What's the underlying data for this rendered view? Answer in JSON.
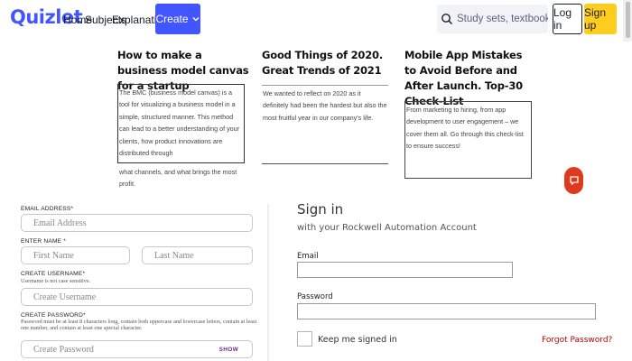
{
  "header": {
    "logo": "Quizlet",
    "nav": [
      "Home",
      "Subjects",
      "Explanations"
    ],
    "create_label": "Create",
    "search_placeholder": "Study sets, textbooks, ...",
    "login_label": "Log in",
    "signup_label": "Sign up",
    "brand_color": "#4255ff",
    "signup_color": "#ffcd1f"
  },
  "articles": [
    {
      "title": "How to make a business model canvas for a startup",
      "excerpt": "The BMC (business model canvas) is a tool for visualizing a business model in a simple, structured manner. This method can lead to a better understanding of your clients, how product innovations are distributed through",
      "excerpt_more": "what channels, and what brings the most profit."
    },
    {
      "title": "Good Things of 2020. Great Trends of 2021",
      "excerpt": "We wanted to reflect on 2020 as it definitely had been the hardest but also the most fruitful year in our company's life."
    },
    {
      "title": "Mobile App Mistakes to Avoid Before and After Launch. Top-30 Check-List",
      "excerpt": "From marketing to hiring, from app development to user engagement – we cover them all. Go through this check-list to ensure success!"
    }
  ],
  "chat_icon": "chat-bubble-icon",
  "registration": {
    "email_label": "EMAIL ADDRESS*",
    "email_placeholder": "Email Address",
    "name_label": "ENTER NAME *",
    "first_name_placeholder": "First Name",
    "last_name_placeholder": "Last Name",
    "username_label": "CREATE USERNAME*",
    "username_hint": "Username is not case sensitive.",
    "username_placeholder": "Create Username",
    "password_label": "CREATE PASSWORD*",
    "password_hint": "Password must be at least 8 characters long, contain both uppercase and lowercase letters, contain at least one number, and contain at least one special character.",
    "password_placeholder": "Create Password",
    "show_label": "SHOW"
  },
  "signin": {
    "title": "Sign in",
    "subtitle": "with your Rockwell Automation Account",
    "email_label": "Email",
    "password_label": "Password",
    "remember_label": "Keep me signed in",
    "forgot_label": "Forgot Password?",
    "forgot_color": "#c00000"
  }
}
